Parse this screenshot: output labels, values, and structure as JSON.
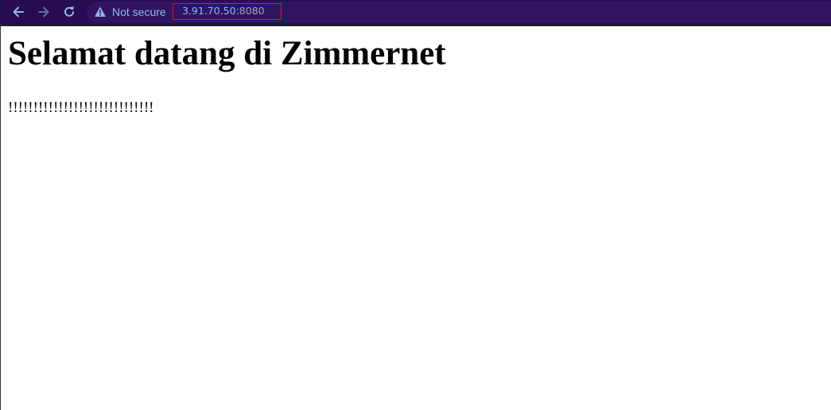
{
  "browser": {
    "security_label": "Not secure",
    "url_host": "3.91.70.50",
    "url_port": ":8080",
    "icons": {
      "back": "arrow-left-icon",
      "forward": "arrow-right-icon",
      "reload": "reload-icon",
      "security": "warning-triangle-icon"
    },
    "colors": {
      "toolbar": "#260d52",
      "omnibox": "#2f1560",
      "icon_accent": "#8fb8e6",
      "annotation": "#e0141e"
    }
  },
  "page": {
    "heading": "Selamat datang di Zimmernet",
    "paragraph": "!!!!!!!!!!!!!!!!!!!!!!!!!!!!!"
  }
}
